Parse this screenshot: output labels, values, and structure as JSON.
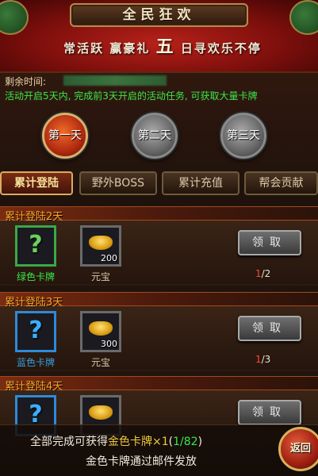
{
  "header": {
    "title": "全民狂欢",
    "banner_pre": "常活跃 赢豪礼",
    "banner_big": "五",
    "banner_post": "日寻欢乐不停"
  },
  "info": {
    "remaining_label": "剩余时间:",
    "activity_note": "活动开启5天内, 完成前3天开启的活动任务, 可获取大量卡牌"
  },
  "days": [
    {
      "label": "第一天"
    },
    {
      "label": "第二天"
    },
    {
      "label": "第三天"
    }
  ],
  "tabs": [
    {
      "label": "累计登陆"
    },
    {
      "label": "野外BOSS"
    },
    {
      "label": "累计充值"
    },
    {
      "label": "帮会贡献"
    }
  ],
  "rows": [
    {
      "header": "累计登陆2天",
      "card_label": "绿色卡牌",
      "ingot_qty": "200",
      "ingot_label": "元宝",
      "claim_label": "领取",
      "progress_current": "1",
      "progress_total": "/2"
    },
    {
      "header": "累计登陆3天",
      "card_label": "蓝色卡牌",
      "ingot_qty": "300",
      "ingot_label": "元宝",
      "claim_label": "领取",
      "progress_current": "1",
      "progress_total": "/3"
    },
    {
      "header": "累计登陆4天",
      "claim_label": "领取"
    }
  ],
  "footer": {
    "line1_pre": "全部完成可获得",
    "line1_gold": "金色卡牌×1",
    "line1_paren_open": "(",
    "line1_count": "1/82",
    "line1_paren_close": ")",
    "line2": "金色卡牌通过邮件发放",
    "back_label": "返回"
  },
  "colors": {
    "accent_gold": "#f0c93a",
    "highlight_green": "#3be74a",
    "row_header_orange": "#ffa92b",
    "progress_red": "#ff4a3a"
  }
}
